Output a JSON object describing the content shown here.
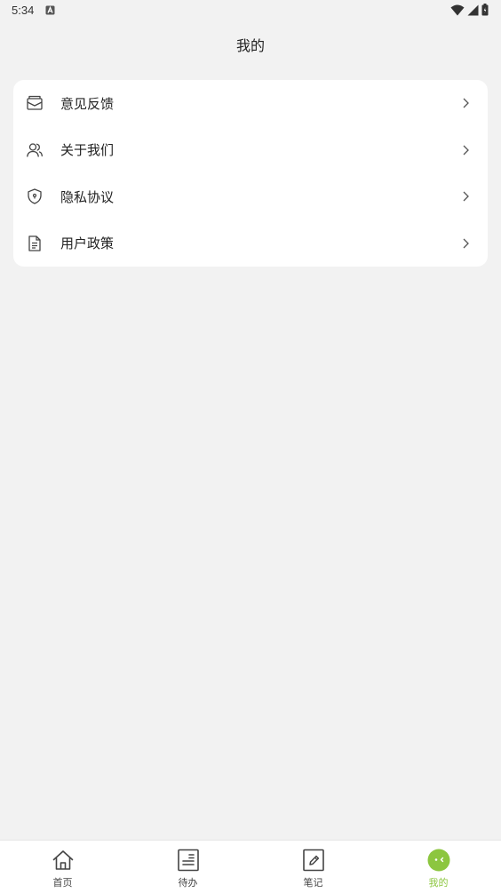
{
  "status_bar": {
    "time": "5:34",
    "notification_icon": "a-badge-icon",
    "icons": [
      "wifi-icon",
      "signal-icon",
      "battery-icon"
    ]
  },
  "header": {
    "title": "我的"
  },
  "menu": {
    "items": [
      {
        "label": "意见反馈",
        "icon": "feedback-mail-icon"
      },
      {
        "label": "关于我们",
        "icon": "users-icon"
      },
      {
        "label": "隐私协议",
        "icon": "shield-icon"
      },
      {
        "label": "用户政策",
        "icon": "document-icon"
      }
    ]
  },
  "tab_bar": {
    "active_color": "#8cc63f",
    "tabs": [
      {
        "label": "首页",
        "icon": "home-icon",
        "active": false
      },
      {
        "label": "待办",
        "icon": "todo-list-icon",
        "active": false
      },
      {
        "label": "笔记",
        "icon": "note-edit-icon",
        "active": false
      },
      {
        "label": "我的",
        "icon": "profile-face-icon",
        "active": true
      }
    ]
  }
}
